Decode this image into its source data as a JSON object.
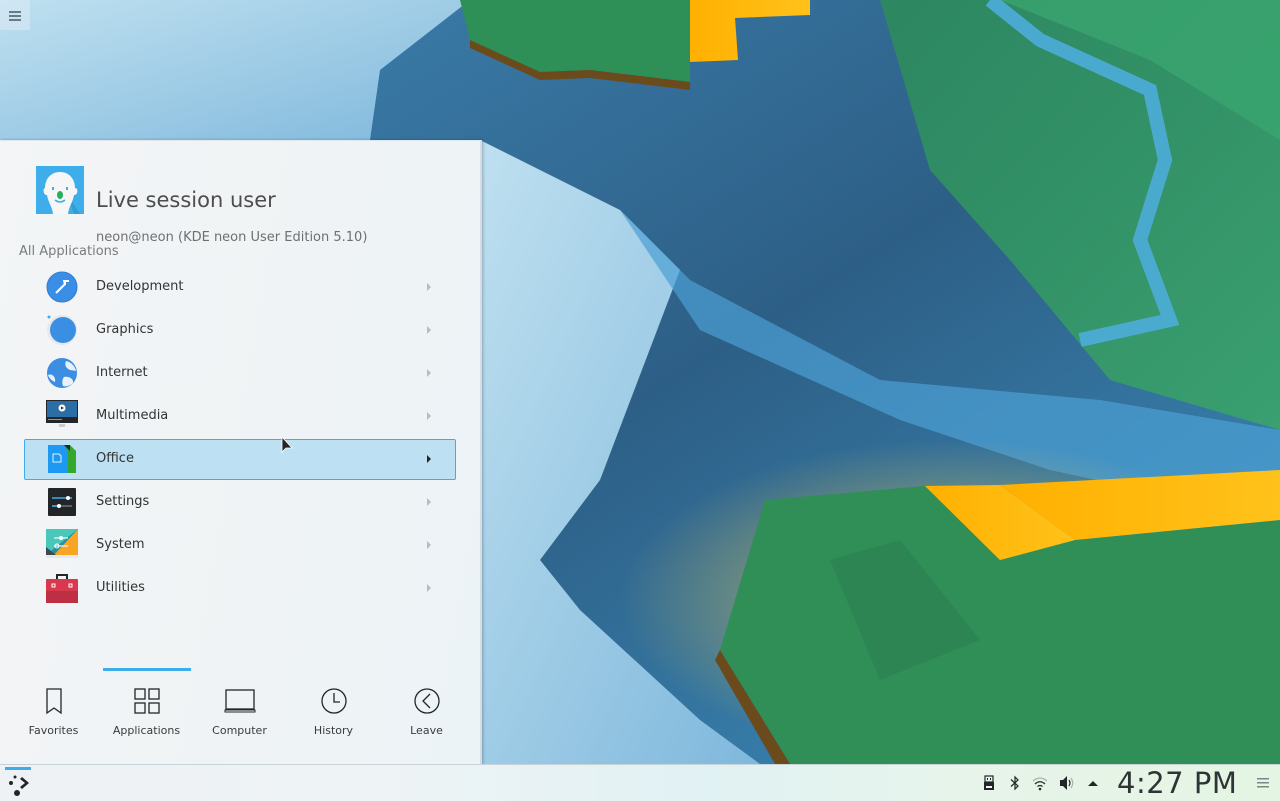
{
  "desktop": {
    "menu_icon": "hamburger-icon"
  },
  "launcher": {
    "user": {
      "name": "Live session user",
      "host": "neon@neon (KDE neon User Edition 5.10)",
      "avatar_icon": "user-face-avatar"
    },
    "section_label": "All Applications",
    "categories": [
      {
        "label": "Development",
        "icon": "development-icon",
        "active": false
      },
      {
        "label": "Graphics",
        "icon": "graphics-icon",
        "active": false
      },
      {
        "label": "Internet",
        "icon": "internet-globe-icon",
        "active": false
      },
      {
        "label": "Multimedia",
        "icon": "multimedia-monitor-icon",
        "active": false
      },
      {
        "label": "Office",
        "icon": "office-icon",
        "active": true
      },
      {
        "label": "Settings",
        "icon": "settings-sliders-icon",
        "active": false
      },
      {
        "label": "System",
        "icon": "system-icon",
        "active": false
      },
      {
        "label": "Utilities",
        "icon": "utilities-toolbox-icon",
        "active": false
      }
    ],
    "tabs": [
      {
        "label": "Favorites",
        "icon": "bookmark-icon",
        "selected": false
      },
      {
        "label": "Applications",
        "icon": "grid-icon",
        "selected": true
      },
      {
        "label": "Computer",
        "icon": "laptop-icon",
        "selected": false
      },
      {
        "label": "History",
        "icon": "clock-icon",
        "selected": false
      },
      {
        "label": "Leave",
        "icon": "leave-arrow-icon",
        "selected": false
      }
    ]
  },
  "taskbar": {
    "launcher_icon": "kde-neon-launcher-icon",
    "tray_icons": [
      "usb-device-icon",
      "bluetooth-icon",
      "wifi-icon",
      "volume-icon",
      "expand-tray-icon"
    ],
    "clock": "4:27 PM",
    "panel_menu_icon": "panel-options-icon"
  },
  "colors": {
    "accent": "#3daee9",
    "highlight_bg": "#bde0f2",
    "text": "#333333"
  }
}
